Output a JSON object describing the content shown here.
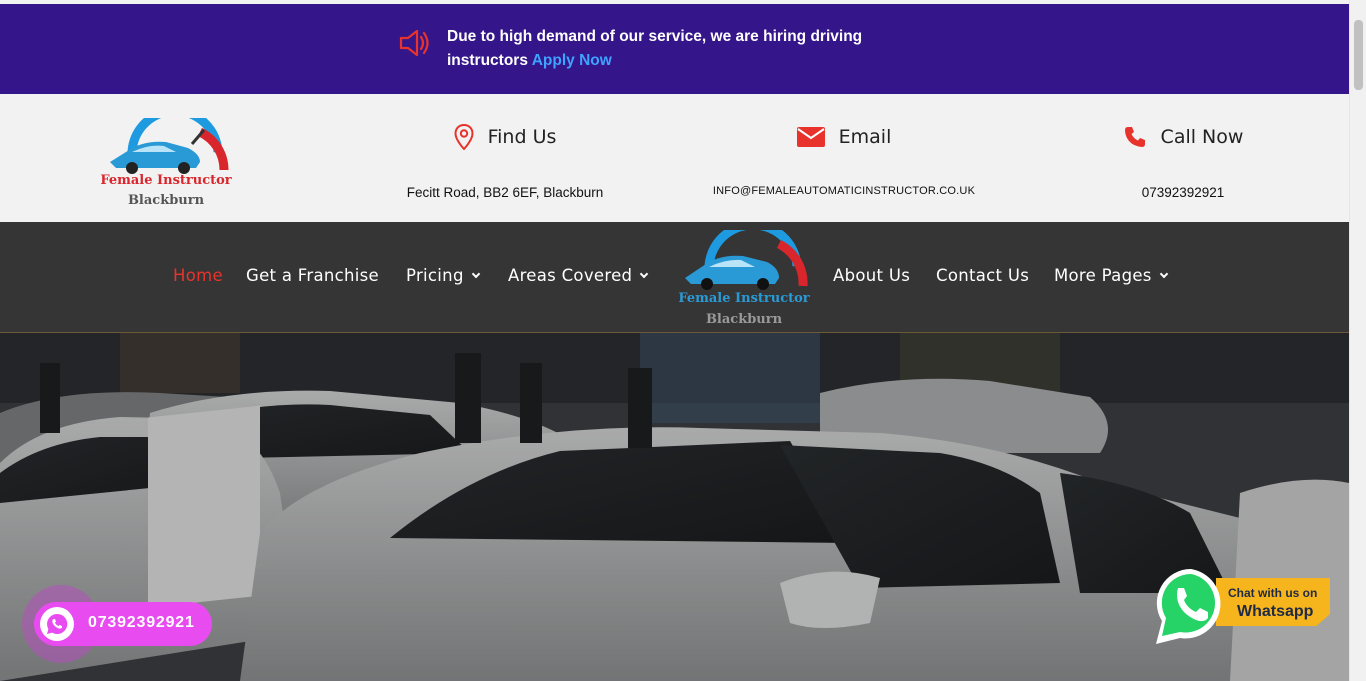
{
  "announcement": {
    "message": "Due to high demand of our service, we are hiring driving instructors",
    "link_label": "Apply Now"
  },
  "brand": {
    "logo_line1": "Female Instructor",
    "logo_line2": "Blackburn"
  },
  "contact": {
    "find": {
      "label": "Find Us",
      "value": "Fecitt Road, BB2 6EF, Blackburn",
      "icon": "location-pin-icon"
    },
    "email": {
      "label": "Email",
      "value": "INFO@FEMALEAUTOMATICINSTRUCTOR.CO.UK",
      "icon": "envelope-icon"
    },
    "call": {
      "label": "Call Now",
      "value": "07392392921",
      "icon": "phone-icon"
    }
  },
  "nav": {
    "items": [
      {
        "label": "Home",
        "active": true
      },
      {
        "label": "Get a Franchise"
      },
      {
        "label": "Pricing",
        "dropdown": true
      },
      {
        "label": "Areas Covered",
        "dropdown": true
      },
      {
        "label": "About Us"
      },
      {
        "label": "Contact Us"
      },
      {
        "label": "More Pages",
        "dropdown": true
      }
    ]
  },
  "float_phone": {
    "number": "07392392921",
    "icon": "whatsapp-icon"
  },
  "whatsapp_widget": {
    "line1": "Chat with us on",
    "line2": "Whatsapp"
  },
  "colors": {
    "announce_bg": "#35168a",
    "accent_red": "#e8332c",
    "link_blue": "#3ea3ff",
    "nav_bg": "#353535",
    "float_pink": "#e84cf0",
    "whatsapp_green": "#25d366",
    "whatsapp_label": "#f7b51d"
  }
}
